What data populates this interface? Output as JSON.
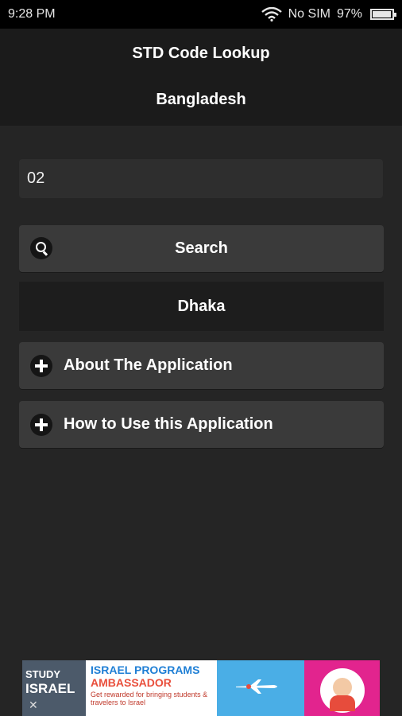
{
  "status_bar": {
    "time": "9:28 PM",
    "carrier": "No SIM",
    "battery": "97%",
    "battery_level": 0.97,
    "wifi_icon": "wifi-icon",
    "battery_icon": "battery-icon"
  },
  "header": {
    "title": "STD Code Lookup",
    "subtitle": "Bangladesh"
  },
  "input": {
    "value": "02"
  },
  "search_button": {
    "label": "Search",
    "icon": "search-icon"
  },
  "result": {
    "text": "Dhaka"
  },
  "sections": [
    {
      "label": "About The Application",
      "icon": "plus-icon"
    },
    {
      "label": "How to Use this Application",
      "icon": "plus-icon"
    }
  ],
  "ad": {
    "study": "STUDY",
    "israel": "ISRAEL",
    "line1": "ISRAEL PROGRAMS",
    "line2": "AMBASSADOR",
    "line3": "Get rewarded for bringing students & travelers to Israel",
    "close_icon": "close-icon"
  },
  "colors": {
    "background": "#252525",
    "header": "#1b1b1b",
    "button": "#3a3a3a",
    "result": "#1d1d1d"
  }
}
